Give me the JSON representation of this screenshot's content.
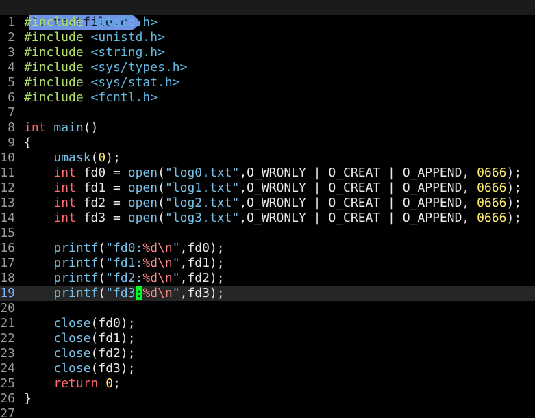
{
  "tab": {
    "label": "1: testfile.c"
  },
  "colors": {
    "background": "#000000",
    "tab": "#6f96e6",
    "cursor": "#00ff20",
    "keyword": "#ff6b6b",
    "function": "#78c0e6",
    "preprocessor": "#b0e06a",
    "number": "#ffeb70"
  },
  "editor": {
    "cursor_line": 19,
    "lines": [
      {
        "n": "1",
        "tokens": [
          {
            "t": "#include ",
            "c": "pp"
          },
          {
            "t": "<stdio.h>",
            "c": "hdr"
          }
        ]
      },
      {
        "n": "2",
        "tokens": [
          {
            "t": "#include ",
            "c": "pp"
          },
          {
            "t": "<unistd.h>",
            "c": "hdr"
          }
        ]
      },
      {
        "n": "3",
        "tokens": [
          {
            "t": "#include ",
            "c": "pp"
          },
          {
            "t": "<string.h>",
            "c": "hdr"
          }
        ]
      },
      {
        "n": "4",
        "tokens": [
          {
            "t": "#include ",
            "c": "pp"
          },
          {
            "t": "<sys/types.h>",
            "c": "hdr"
          }
        ]
      },
      {
        "n": "5",
        "tokens": [
          {
            "t": "#include ",
            "c": "pp"
          },
          {
            "t": "<sys/stat.h>",
            "c": "hdr"
          }
        ]
      },
      {
        "n": "6",
        "tokens": [
          {
            "t": "#include ",
            "c": "pp"
          },
          {
            "t": "<fcntl.h>",
            "c": "hdr"
          }
        ]
      },
      {
        "n": "7",
        "tokens": []
      },
      {
        "n": "8",
        "tokens": [
          {
            "t": "int",
            "c": "kw"
          },
          {
            "t": " ",
            "c": "code"
          },
          {
            "t": "main",
            "c": "fn"
          },
          {
            "t": "()",
            "c": "code"
          }
        ]
      },
      {
        "n": "9",
        "tokens": [
          {
            "t": "{",
            "c": "code"
          }
        ]
      },
      {
        "n": "10",
        "tokens": [
          {
            "t": "    ",
            "c": "code"
          },
          {
            "t": "umask",
            "c": "fn"
          },
          {
            "t": "(",
            "c": "code"
          },
          {
            "t": "0",
            "c": "num"
          },
          {
            "t": ");",
            "c": "code"
          }
        ]
      },
      {
        "n": "11",
        "tokens": [
          {
            "t": "    ",
            "c": "code"
          },
          {
            "t": "int",
            "c": "kw"
          },
          {
            "t": " fd0 = ",
            "c": "code"
          },
          {
            "t": "open",
            "c": "fn"
          },
          {
            "t": "(",
            "c": "code"
          },
          {
            "t": "\"log0.txt\"",
            "c": "str"
          },
          {
            "t": ",O_WRONLY | O_CREAT | O_APPEND, ",
            "c": "code"
          },
          {
            "t": "0666",
            "c": "num"
          },
          {
            "t": ");",
            "c": "code"
          }
        ]
      },
      {
        "n": "12",
        "tokens": [
          {
            "t": "    ",
            "c": "code"
          },
          {
            "t": "int",
            "c": "kw"
          },
          {
            "t": " fd1 = ",
            "c": "code"
          },
          {
            "t": "open",
            "c": "fn"
          },
          {
            "t": "(",
            "c": "code"
          },
          {
            "t": "\"log1.txt\"",
            "c": "str"
          },
          {
            "t": ",O_WRONLY | O_CREAT | O_APPEND, ",
            "c": "code"
          },
          {
            "t": "0666",
            "c": "num"
          },
          {
            "t": ");",
            "c": "code"
          }
        ]
      },
      {
        "n": "13",
        "tokens": [
          {
            "t": "    ",
            "c": "code"
          },
          {
            "t": "int",
            "c": "kw"
          },
          {
            "t": " fd2 = ",
            "c": "code"
          },
          {
            "t": "open",
            "c": "fn"
          },
          {
            "t": "(",
            "c": "code"
          },
          {
            "t": "\"log2.txt\"",
            "c": "str"
          },
          {
            "t": ",O_WRONLY | O_CREAT | O_APPEND, ",
            "c": "code"
          },
          {
            "t": "0666",
            "c": "num"
          },
          {
            "t": ");",
            "c": "code"
          }
        ]
      },
      {
        "n": "14",
        "tokens": [
          {
            "t": "    ",
            "c": "code"
          },
          {
            "t": "int",
            "c": "kw"
          },
          {
            "t": " fd3 = ",
            "c": "code"
          },
          {
            "t": "open",
            "c": "fn"
          },
          {
            "t": "(",
            "c": "code"
          },
          {
            "t": "\"log3.txt\"",
            "c": "str"
          },
          {
            "t": ",O_WRONLY | O_CREAT | O_APPEND, ",
            "c": "code"
          },
          {
            "t": "0666",
            "c": "num"
          },
          {
            "t": ");",
            "c": "code"
          }
        ]
      },
      {
        "n": "15",
        "tokens": []
      },
      {
        "n": "16",
        "tokens": [
          {
            "t": "    ",
            "c": "code"
          },
          {
            "t": "printf",
            "c": "fn"
          },
          {
            "t": "(",
            "c": "code"
          },
          {
            "t": "\"fd0:",
            "c": "str"
          },
          {
            "t": "%d\\n",
            "c": "esc"
          },
          {
            "t": "\"",
            "c": "str"
          },
          {
            "t": ",fd0);",
            "c": "code"
          }
        ]
      },
      {
        "n": "17",
        "tokens": [
          {
            "t": "    ",
            "c": "code"
          },
          {
            "t": "printf",
            "c": "fn"
          },
          {
            "t": "(",
            "c": "code"
          },
          {
            "t": "\"fd1:",
            "c": "str"
          },
          {
            "t": "%d\\n",
            "c": "esc"
          },
          {
            "t": "\"",
            "c": "str"
          },
          {
            "t": ",fd1);",
            "c": "code"
          }
        ]
      },
      {
        "n": "18",
        "tokens": [
          {
            "t": "    ",
            "c": "code"
          },
          {
            "t": "printf",
            "c": "fn"
          },
          {
            "t": "(",
            "c": "code"
          },
          {
            "t": "\"fd2:",
            "c": "str"
          },
          {
            "t": "%d\\n",
            "c": "esc"
          },
          {
            "t": "\"",
            "c": "str"
          },
          {
            "t": ",fd2);",
            "c": "code"
          }
        ]
      },
      {
        "n": "19",
        "tokens": [
          {
            "t": "    ",
            "c": "code"
          },
          {
            "t": "printf",
            "c": "fn"
          },
          {
            "t": "(",
            "c": "code"
          },
          {
            "t": "\"fd3",
            "c": "str"
          },
          {
            "t": ":",
            "c": "cursor"
          },
          {
            "t": "%d\\n",
            "c": "esc"
          },
          {
            "t": "\"",
            "c": "str"
          },
          {
            "t": ",fd3);",
            "c": "code"
          }
        ]
      },
      {
        "n": "20",
        "tokens": []
      },
      {
        "n": "21",
        "tokens": [
          {
            "t": "    ",
            "c": "code"
          },
          {
            "t": "close",
            "c": "fn"
          },
          {
            "t": "(fd0);",
            "c": "code"
          }
        ]
      },
      {
        "n": "22",
        "tokens": [
          {
            "t": "    ",
            "c": "code"
          },
          {
            "t": "close",
            "c": "fn"
          },
          {
            "t": "(fd1);",
            "c": "code"
          }
        ]
      },
      {
        "n": "23",
        "tokens": [
          {
            "t": "    ",
            "c": "code"
          },
          {
            "t": "close",
            "c": "fn"
          },
          {
            "t": "(fd2);",
            "c": "code"
          }
        ]
      },
      {
        "n": "24",
        "tokens": [
          {
            "t": "    ",
            "c": "code"
          },
          {
            "t": "close",
            "c": "fn"
          },
          {
            "t": "(fd3);",
            "c": "code"
          }
        ]
      },
      {
        "n": "25",
        "tokens": [
          {
            "t": "    ",
            "c": "code"
          },
          {
            "t": "return",
            "c": "kw"
          },
          {
            "t": " ",
            "c": "code"
          },
          {
            "t": "0",
            "c": "num"
          },
          {
            "t": ";",
            "c": "code"
          }
        ]
      },
      {
        "n": "26",
        "tokens": [
          {
            "t": "}",
            "c": "code"
          }
        ]
      },
      {
        "n": "27",
        "tokens": []
      }
    ]
  }
}
